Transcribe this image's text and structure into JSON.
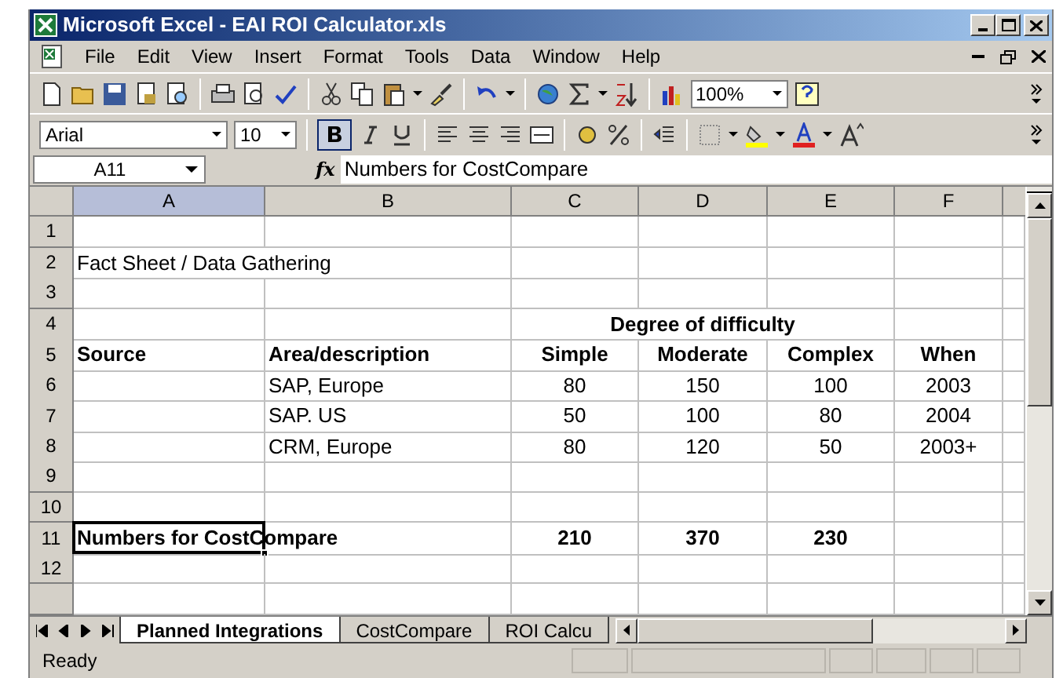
{
  "window": {
    "title": "Microsoft Excel - EAI ROI Calculator.xls"
  },
  "menu": [
    "File",
    "Edit",
    "View",
    "Insert",
    "Format",
    "Tools",
    "Data",
    "Window",
    "Help"
  ],
  "standard_toolbar": {
    "zoom": "100%"
  },
  "formatting_toolbar": {
    "font": "Arial",
    "size": "10",
    "bold_pressed": true
  },
  "formula_bar": {
    "name_box": "A11",
    "fx": "fx",
    "formula": "Numbers for CostCompare"
  },
  "columns": [
    {
      "label": "A",
      "selected": true
    },
    {
      "label": "B",
      "selected": false
    },
    {
      "label": "C",
      "selected": false
    },
    {
      "label": "D",
      "selected": false
    },
    {
      "label": "E",
      "selected": false
    },
    {
      "label": "F",
      "selected": false
    }
  ],
  "rows": [
    {
      "label": "1",
      "cells": {}
    },
    {
      "label": "2",
      "cells": {
        "A": {
          "text": "Fact Sheet / Data Gathering",
          "bold": false
        }
      }
    },
    {
      "label": "3",
      "cells": {}
    },
    {
      "label": "4",
      "cells": {
        "D": {
          "text": "Degree of difficulty",
          "bold": true
        }
      }
    },
    {
      "label": "5",
      "cells": {
        "A": {
          "text": "Source",
          "bold": true
        },
        "B": {
          "text": "Area/description",
          "bold": true
        },
        "C": {
          "text": "Simple",
          "bold": true
        },
        "D": {
          "text": "Moderate",
          "bold": true
        },
        "E": {
          "text": "Complex",
          "bold": true
        },
        "F": {
          "text": "When",
          "bold": true
        }
      }
    },
    {
      "label": "6",
      "cells": {
        "B": {
          "text": "SAP, Europe",
          "bold": false
        },
        "C": {
          "text": "80",
          "bold": false
        },
        "D": {
          "text": "150",
          "bold": false
        },
        "E": {
          "text": "100",
          "bold": false
        },
        "F": {
          "text": "2003",
          "bold": false
        }
      }
    },
    {
      "label": "7",
      "cells": {
        "B": {
          "text": "SAP. US",
          "bold": false
        },
        "C": {
          "text": "50",
          "bold": false
        },
        "D": {
          "text": "100",
          "bold": false
        },
        "E": {
          "text": "80",
          "bold": false
        },
        "F": {
          "text": "2004",
          "bold": false
        }
      }
    },
    {
      "label": "8",
      "cells": {
        "B": {
          "text": "CRM, Europe",
          "bold": false
        },
        "C": {
          "text": "80",
          "bold": false
        },
        "D": {
          "text": "120",
          "bold": false
        },
        "E": {
          "text": "50",
          "bold": false
        },
        "F": {
          "text": "2003+",
          "bold": false
        }
      }
    },
    {
      "label": "9",
      "cells": {}
    },
    {
      "label": "10",
      "cells": {}
    },
    {
      "label": "11",
      "cells": {
        "A": {
          "text": "Numbers for CostCompare",
          "bold": true,
          "selected": true
        },
        "C": {
          "text": "210",
          "bold": true
        },
        "D": {
          "text": "370",
          "bold": true
        },
        "E": {
          "text": "230",
          "bold": true
        }
      }
    },
    {
      "label": "12",
      "cells": {}
    }
  ],
  "sheet_tabs": [
    {
      "label": "Planned Integrations",
      "selected": true
    },
    {
      "label": "CostCompare",
      "selected": false
    },
    {
      "label": "ROI Calcu",
      "selected": false
    }
  ],
  "status_bar": "Ready"
}
